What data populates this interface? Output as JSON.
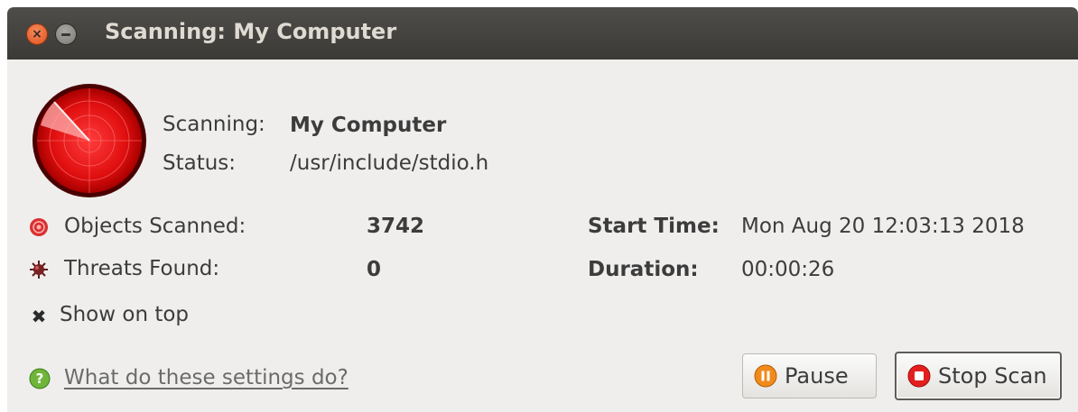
{
  "window": {
    "title": "Scanning: My Computer",
    "controls": {
      "close_icon": "close-icon",
      "minimize_icon": "minimize-icon"
    }
  },
  "scan": {
    "scanning_label": "Scanning:",
    "scanning_value": "My Computer",
    "status_label": "Status:",
    "status_value": "/usr/include/stdio.h"
  },
  "stats": {
    "objects_label": "Objects Scanned:",
    "objects_value": "3742",
    "threats_label": "Threats Found:",
    "threats_value": "0",
    "start_label": "Start Time:",
    "start_value": "Mon Aug 20 12:03:13 2018",
    "duration_label": "Duration:",
    "duration_value": "00:00:26"
  },
  "options": {
    "show_on_top_label": "Show on top",
    "show_on_top_checked": true
  },
  "help": {
    "link_text": "What do these settings do?"
  },
  "buttons": {
    "pause_label": "Pause",
    "stop_label": "Stop Scan"
  },
  "colors": {
    "radar_red": "#e01010",
    "titlebar": "#3c3b37",
    "background": "#efeeed"
  }
}
